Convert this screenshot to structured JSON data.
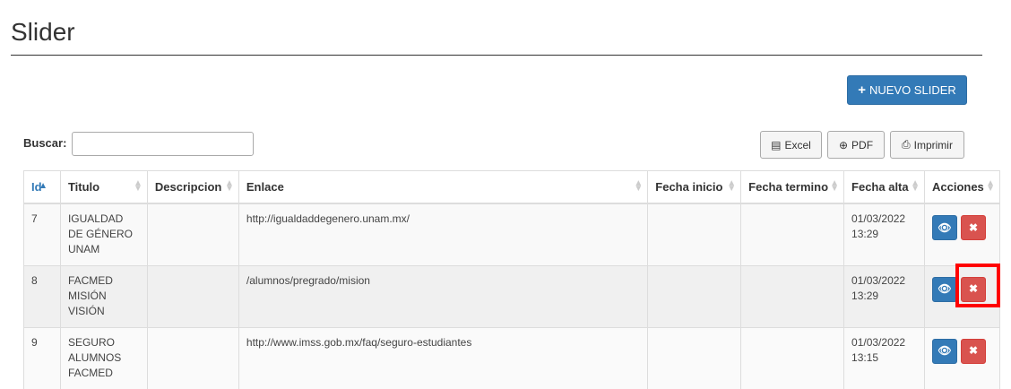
{
  "page": {
    "title": "Slider"
  },
  "toolbar": {
    "new_label": "NUEVO SLIDER"
  },
  "search": {
    "label": "Buscar:",
    "value": ""
  },
  "export": {
    "excel": "Excel",
    "pdf": "PDF",
    "print": "Imprimir"
  },
  "table": {
    "headers": [
      "Id",
      "Titulo",
      "Descripcion",
      "Enlace",
      "Fecha inicio",
      "Fecha termino",
      "Fecha alta",
      "Acciones"
    ],
    "rows": [
      {
        "id": "7",
        "titulo": "IGUALDAD DE GÉNERO UNAM",
        "descripcion": "",
        "enlace": "http://igualdaddegenero.unam.mx/",
        "fecha_inicio": "",
        "fecha_termino": "",
        "fecha_alta": "01/03/2022 13:29"
      },
      {
        "id": "8",
        "titulo": "FACMED MISIÓN VISIÓN",
        "descripcion": "",
        "enlace": "/alumnos/pregrado/mision",
        "fecha_inicio": "",
        "fecha_termino": "",
        "fecha_alta": "01/03/2022 13:29"
      },
      {
        "id": "9",
        "titulo": "SEGURO ALUMNOS FACMED",
        "descripcion": "",
        "enlace": "http://www.imss.gob.mx/faq/seguro-estudiantes",
        "fecha_inicio": "",
        "fecha_termino": "",
        "fecha_alta": "01/03/2022 13:15"
      }
    ]
  },
  "colors": {
    "primary": "#337ab7",
    "danger": "#d9534f",
    "highlight": "#ff0000"
  }
}
